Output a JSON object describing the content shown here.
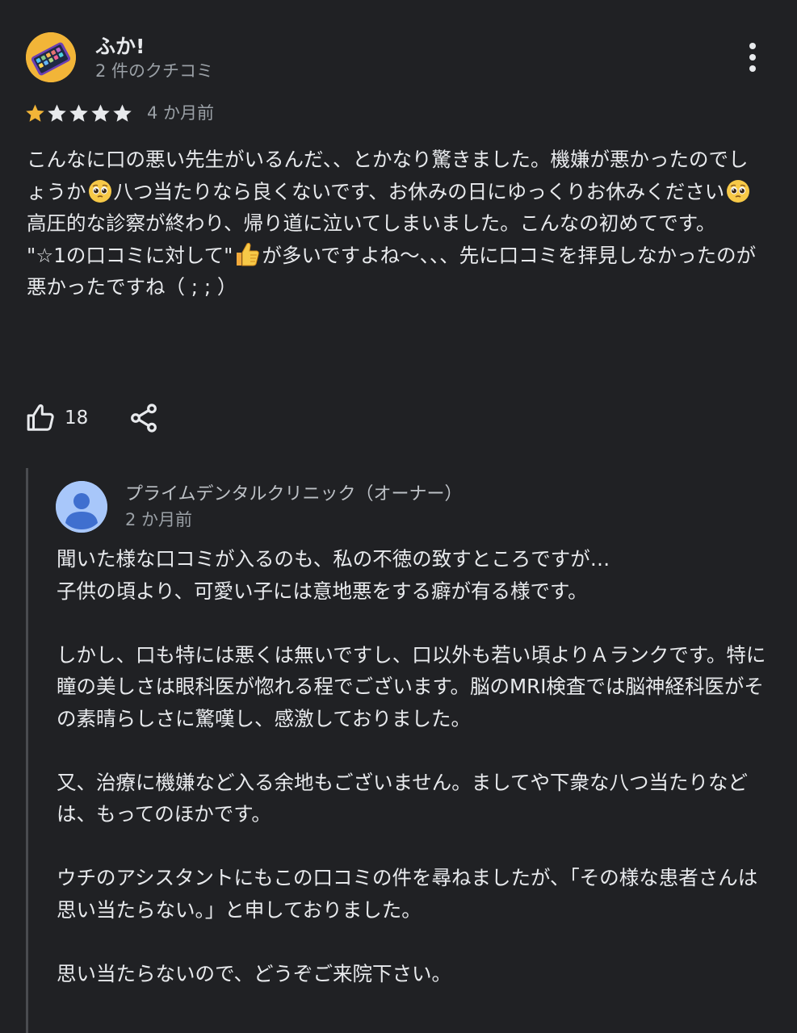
{
  "review": {
    "author_name": "ふか!",
    "author_meta": "2 件のクチコミ",
    "rating": 1,
    "rating_max": 5,
    "date": "4 か月前",
    "body": [
      {
        "a": "こんなに口の悪い先生がいるんだ、、とかなり驚きました。機嫌が悪かったのでしょうか",
        "b": "八つ当たりなら良くないです、お休みの日にゆっくりお休みください"
      },
      {
        "text": "高圧的な診察が終わり、帰り道に泣いてしまいました。こんなの初めてです。"
      },
      {
        "a": "\"☆1の口コミに対して\"",
        "b": "が多いですよね〜、、、先に口コミを拝見しなかったのが悪かったですね（ ; ; ）"
      }
    ],
    "like_count": "18"
  },
  "reply": {
    "owner_name": "プライムデンタルクリニック（オーナー）",
    "date": "2 か月前",
    "paragraphs": [
      "聞いた様な口コミが入るのも、私の不徳の致すところですが…",
      "子供の頃より、可愛い子には意地悪をする癖が有る様です。",
      "しかし、口も特には悪くは無いですし、口以外も若い頃よりＡランクです。特に瞳の美しさは眼科医が惚れる程でございます。脳のMRI検査では脳神経科医がその素晴らしさに驚嘆し、感激しておりました。",
      "又、治療に機嫌など入る余地もございません。ましてや下衆な八つ当たりなどは、もってのほかです。",
      "ウチのアシスタントにもこの口コミの件を尋ねましたが、「その様な患者さんは思い当たらない。」と申しておりました。",
      "思い当たらないので、どうぞご来院下さい。"
    ]
  },
  "icons": {
    "avatar": "phone-apps-avatar-icon",
    "more": "more-vert-icon",
    "star": "star-icon",
    "like": "thumb-up-icon",
    "share": "share-icon",
    "owner_avatar": "person-avatar-icon",
    "emoji_pleading": "pleading-face-emoji",
    "emoji_thumbs": "thumbs-up-emoji"
  },
  "colors": {
    "background": "#202124",
    "text": "#e8eaed",
    "secondary_text": "#9aa0a6",
    "star_filled": "#f2b538",
    "star_empty": "#e8eaed",
    "owner_avatar_bg": "#a8c7fa",
    "owner_avatar_fg": "#3f6fcf",
    "reply_rule": "#4a4c50"
  }
}
